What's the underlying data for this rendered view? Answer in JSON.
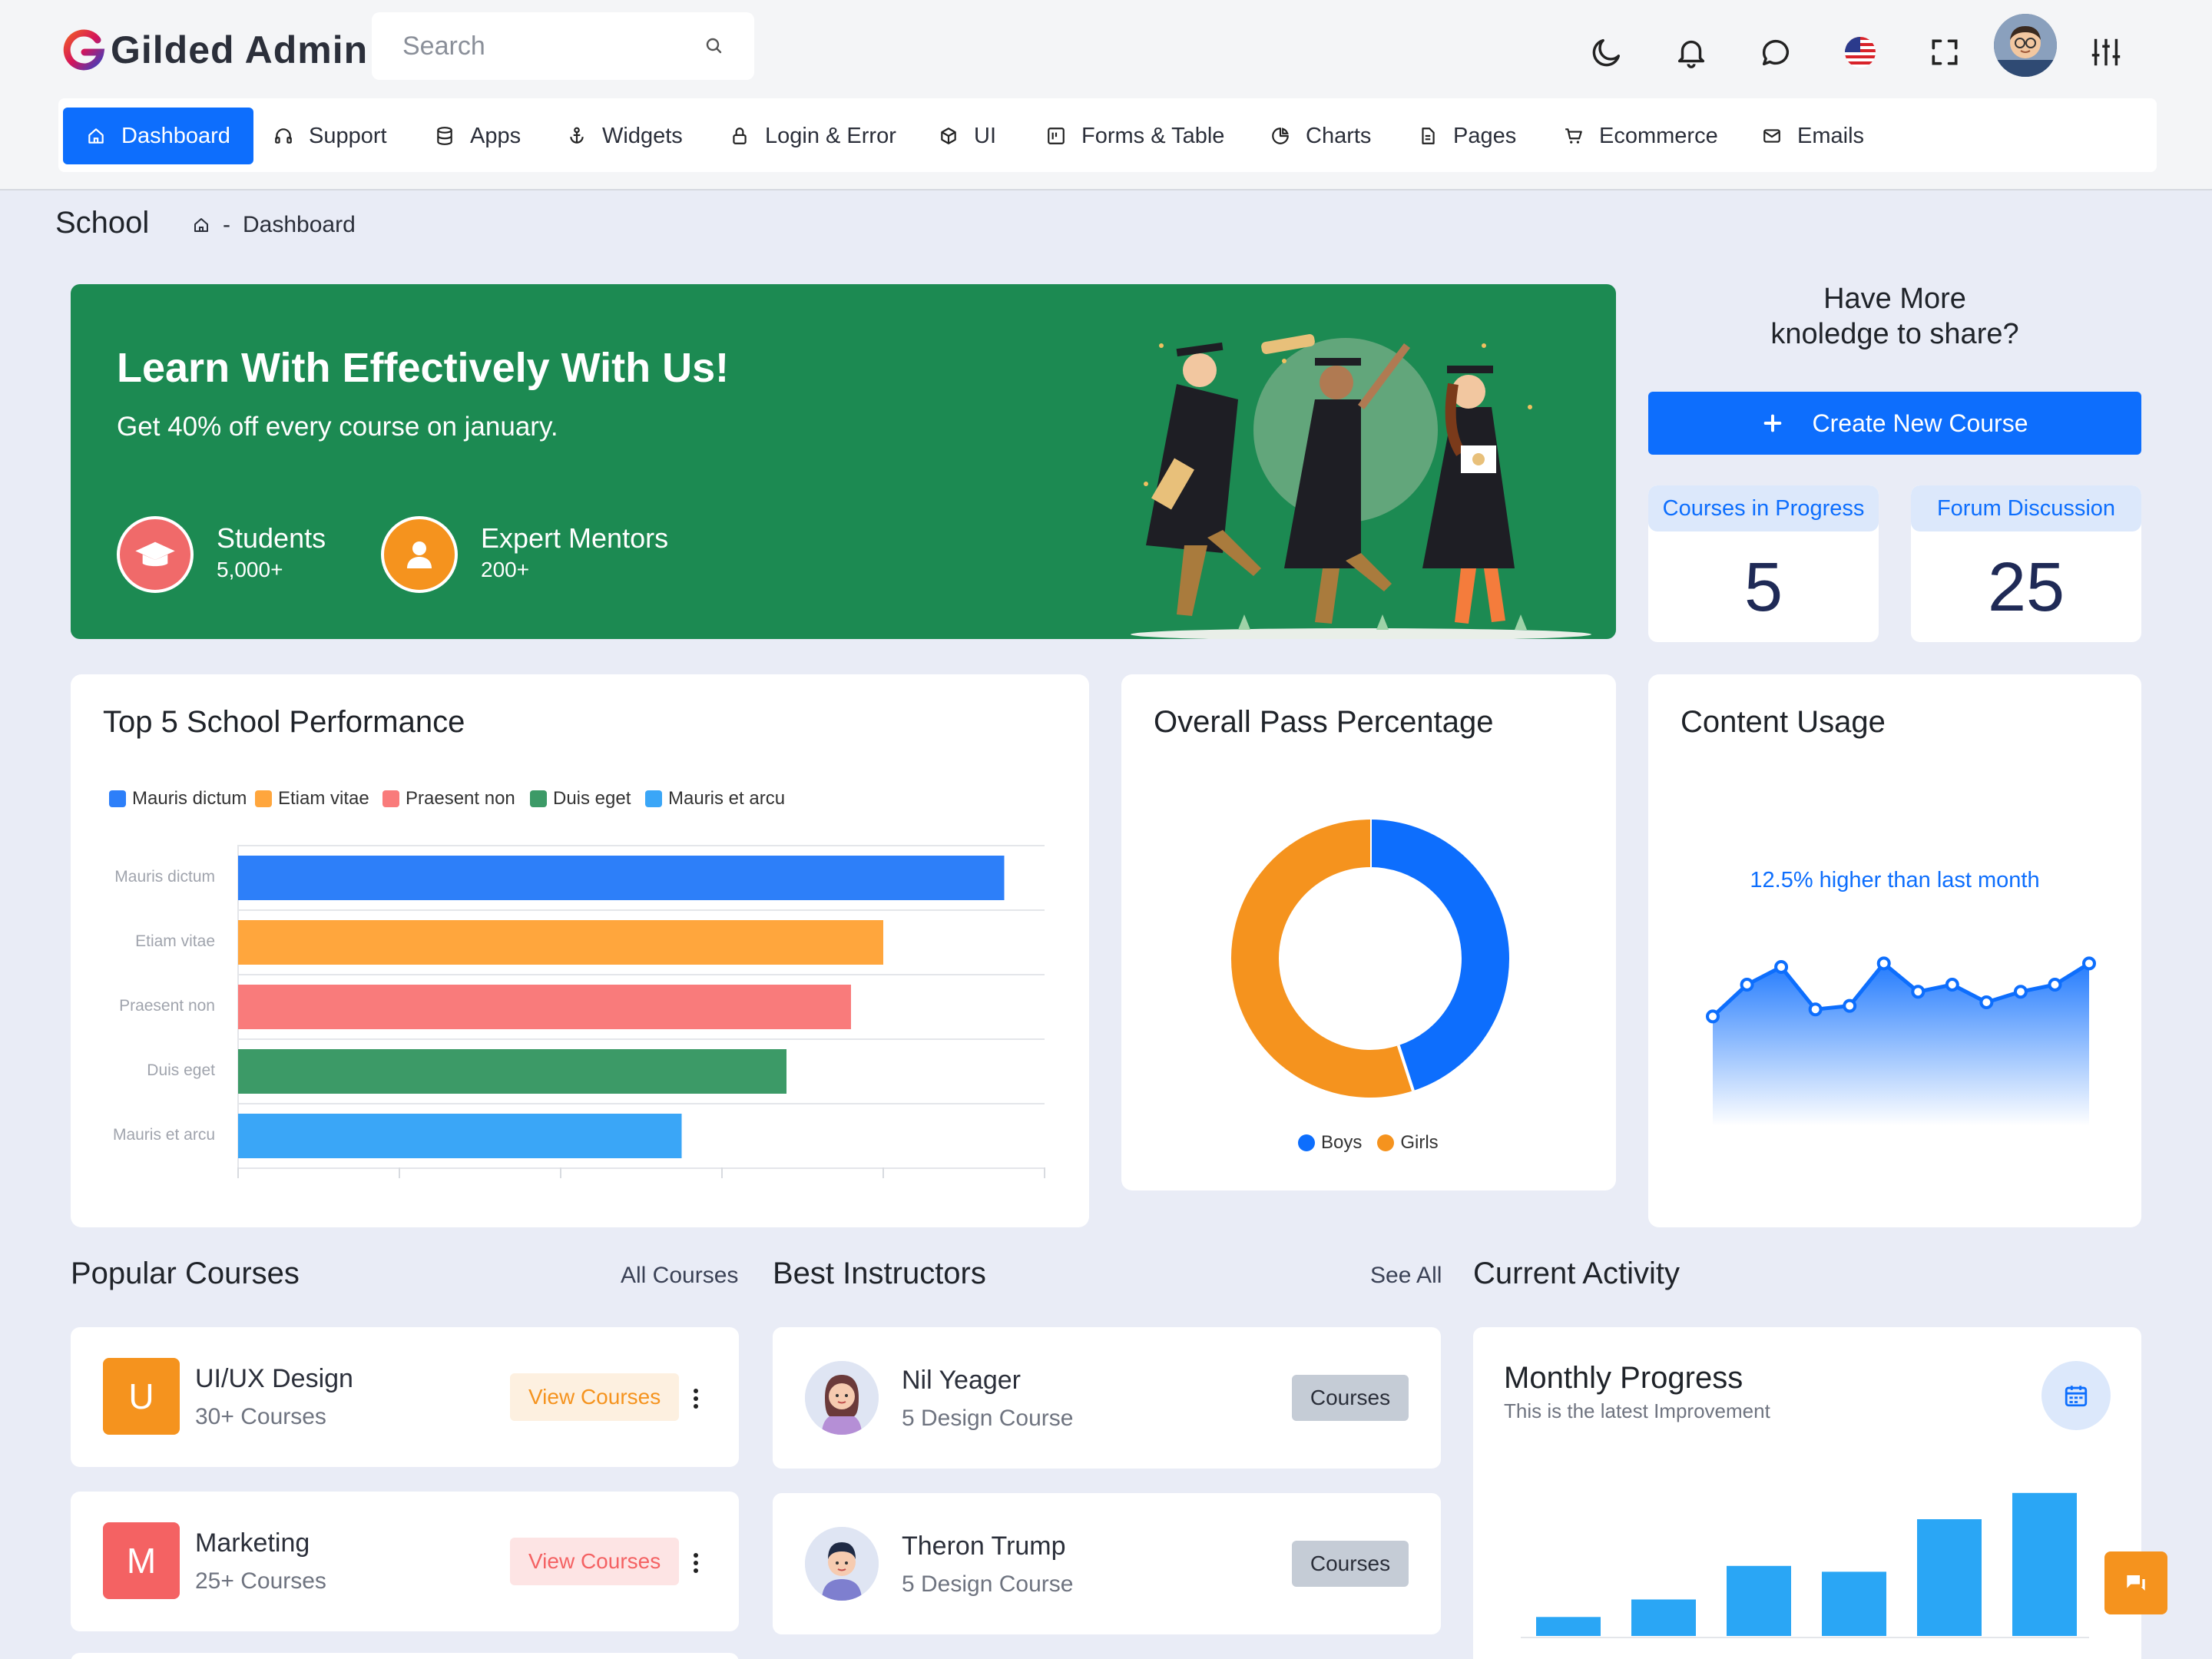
{
  "header": {
    "brand": "Gilded Admin",
    "search_placeholder": "Search"
  },
  "menu": [
    {
      "label": "Dashboard",
      "icon": "home-icon",
      "active": true
    },
    {
      "label": "Support",
      "icon": "headphones-icon"
    },
    {
      "label": "Apps",
      "icon": "database-icon"
    },
    {
      "label": "Widgets",
      "icon": "anchor-icon"
    },
    {
      "label": "Login & Error",
      "icon": "lock-icon"
    },
    {
      "label": "UI",
      "icon": "box-icon"
    },
    {
      "label": "Forms & Table",
      "icon": "layout-icon"
    },
    {
      "label": "Charts",
      "icon": "pie-chart-icon"
    },
    {
      "label": "Pages",
      "icon": "file-icon"
    },
    {
      "label": "Ecommerce",
      "icon": "cart-icon"
    },
    {
      "label": "Emails",
      "icon": "mail-icon"
    }
  ],
  "page": {
    "title": "School",
    "breadcrumb_separator": "-",
    "breadcrumb": "Dashboard"
  },
  "banner": {
    "title": "Learn With Effectively With Us!",
    "subtitle": "Get 40% off every course on january.",
    "stats": [
      {
        "label": "Students",
        "value": "5,000+",
        "color": "#f06a6a"
      },
      {
        "label": "Expert Mentors",
        "value": "200+",
        "color": "#f5931e"
      }
    ]
  },
  "share": {
    "title_line1": "Have More",
    "title_line2": "knoledge to share?",
    "button_label": "Create New Course",
    "cards": [
      {
        "label": "Courses in Progress",
        "value": "5"
      },
      {
        "label": "Forum Discussion",
        "value": "25"
      }
    ]
  },
  "performance": {
    "title": "Top 5 School Performance"
  },
  "pass": {
    "title": "Overall Pass Percentage"
  },
  "usage": {
    "title": "Content Usage",
    "note": "12.5% higher than last month"
  },
  "chart_data": [
    {
      "type": "bar",
      "orientation": "horizontal",
      "categories": [
        "Mauris dictum",
        "Etiam vitae",
        "Praesent non",
        "Duis eget",
        "Mauris et arcu"
      ],
      "values": [
        950,
        800,
        760,
        680,
        550
      ],
      "colors": [
        "#2d7ff9",
        "#ffa63d",
        "#f97b7b",
        "#3c9a67",
        "#3aa6f7"
      ],
      "legend": [
        "Mauris dictum",
        "Etiam vitae",
        "Praesent non",
        "Duis eget",
        "Mauris et arcu"
      ],
      "legend_position": "top-left",
      "xlim": [
        0,
        1000
      ],
      "grid": true
    },
    {
      "type": "pie",
      "donut": true,
      "labels": [
        "Boys",
        "Girls"
      ],
      "values": [
        45,
        55
      ],
      "colors": [
        "#0d6efd",
        "#f5931e"
      ],
      "legend_position": "bottom"
    },
    {
      "type": "area",
      "x": [
        1,
        2,
        3,
        4,
        5,
        6,
        7,
        8,
        9,
        10,
        11,
        12
      ],
      "values": [
        31,
        40,
        45,
        33,
        34,
        46,
        38,
        40,
        35,
        38,
        40,
        46
      ],
      "ylim": [
        0,
        50
      ],
      "color": "#0d6efd",
      "grid": false
    },
    {
      "type": "bar",
      "categories": [
        "1",
        "2",
        "3",
        "4",
        "5",
        "6"
      ],
      "values": [
        13,
        25,
        48,
        44,
        80,
        98
      ],
      "ylim": [
        0,
        100
      ],
      "color": "#2aa6f5",
      "grid": false
    }
  ],
  "popular": {
    "title": "Popular Courses",
    "link": "All Courses",
    "items": [
      {
        "letter": "U",
        "title": "UI/UX Design",
        "sub": "30+ Courses",
        "button": "View Courses",
        "color": "#f5931e",
        "btn_bg": "#fdf0e0",
        "btn_fg": "#f5931e"
      },
      {
        "letter": "M",
        "title": "Marketing",
        "sub": "25+ Courses",
        "button": "View Courses",
        "color": "#f46263",
        "btn_bg": "#fde4e4",
        "btn_fg": "#f46263"
      }
    ]
  },
  "instructors": {
    "title": "Best Instructors",
    "link": "See All",
    "items": [
      {
        "name": "Nil Yeager",
        "sub": "5 Design Course",
        "button": "Courses"
      },
      {
        "name": "Theron Trump",
        "sub": "5 Design Course",
        "button": "Courses"
      }
    ]
  },
  "activity": {
    "title": "Current Activity",
    "card_title": "Monthly Progress",
    "card_sub": "This is the latest Improvement"
  }
}
